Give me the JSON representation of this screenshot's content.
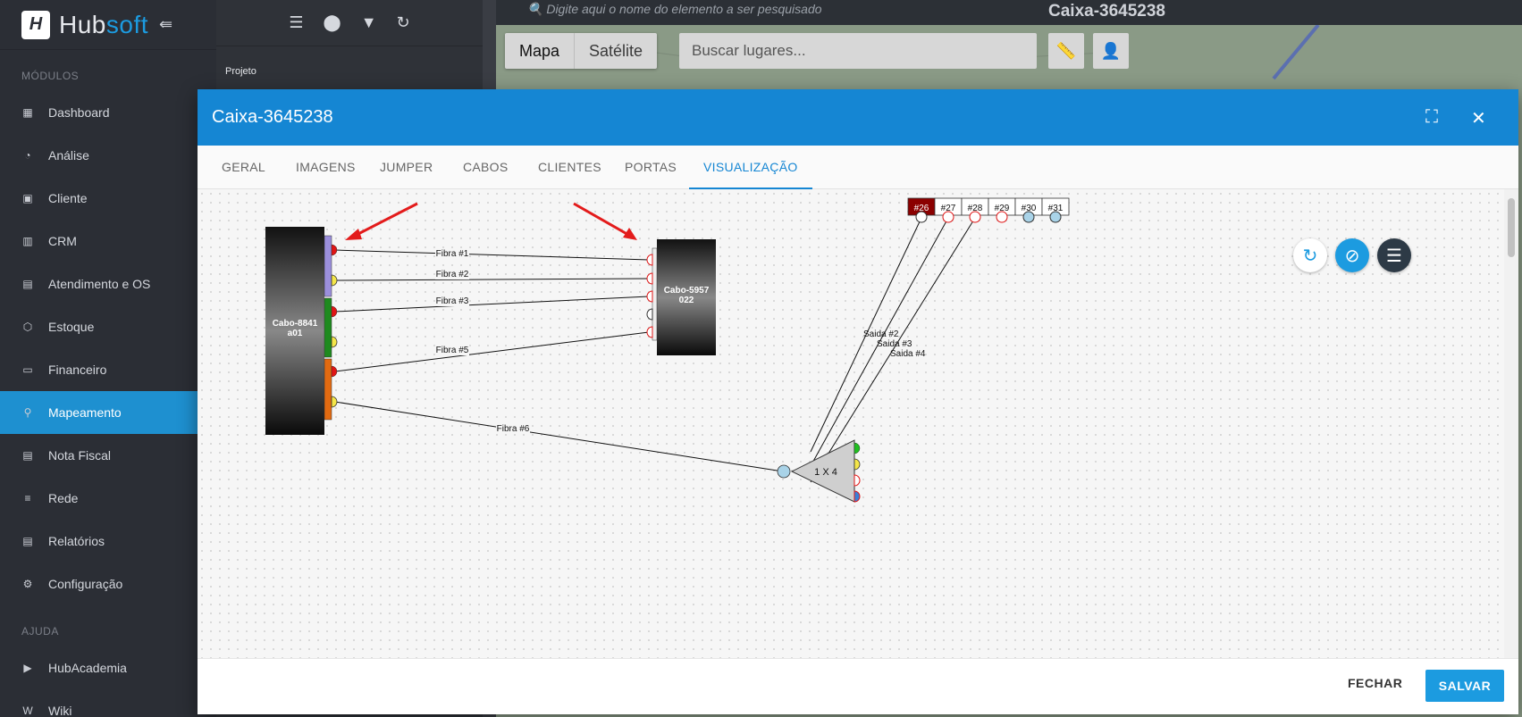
{
  "brand": {
    "hub": "Hub",
    "soft": "soft",
    "mark": "H",
    "collapse_icon": "collapse-menu-icon"
  },
  "sidebar": {
    "modules_label": "MÓDULOS",
    "items": [
      {
        "label": "Dashboard",
        "icon": "dashboard-icon"
      },
      {
        "label": "Análise",
        "icon": "pie-chart-icon"
      },
      {
        "label": "Cliente",
        "icon": "contact-card-icon",
        "chevron": true
      },
      {
        "label": "CRM",
        "icon": "trello-icon"
      },
      {
        "label": "Atendimento e OS",
        "icon": "calendar-clock-icon"
      },
      {
        "label": "Estoque",
        "icon": "box-icon"
      },
      {
        "label": "Financeiro",
        "icon": "money-icon"
      },
      {
        "label": "Mapeamento",
        "icon": "map-pin-icon",
        "active": true
      },
      {
        "label": "Nota Fiscal",
        "icon": "document-icon"
      },
      {
        "label": "Rede",
        "icon": "server-icon"
      },
      {
        "label": "Relatórios",
        "icon": "report-icon"
      },
      {
        "label": "Configuração",
        "icon": "gear-icon",
        "chevron": true
      }
    ],
    "help_label": "AJUDA",
    "help_items": [
      {
        "label": "HubAcademia",
        "icon": "youtube-icon"
      },
      {
        "label": "Wiki",
        "icon": "wikipedia-icon"
      }
    ]
  },
  "subpanel": {
    "project_label": "Projeto"
  },
  "map": {
    "search_placeholder": "Digite aqui o nome do elemento a ser pesquisado",
    "title": "Caixa-3645238",
    "type_map": "Mapa",
    "type_satellite": "Satélite",
    "places_placeholder": "Buscar lugares..."
  },
  "modal": {
    "title": "Caixa-3645238",
    "tabs": [
      "GERAL",
      "IMAGENS",
      "JUMPER",
      "CABOS",
      "CLIENTES",
      "PORTAS",
      "VISUALIZAÇÃO"
    ],
    "active_tab": "VISUALIZAÇÃO",
    "close_label": "FECHAR",
    "save_label": "SALVAR"
  },
  "diagram": {
    "cable_left": "Cabo-8841 a01",
    "cable_left_lines": [
      "Cabo-8841",
      "a01"
    ],
    "cable_right_lines": [
      "Cabo-5957",
      "022"
    ],
    "splitter_label": "1 X 4",
    "fibers": [
      "Fibra #1",
      "Fibra #2",
      "Fibra #3",
      "Fibra #5",
      "Fibra #6"
    ],
    "outputs": [
      "Saida #2",
      "Saida #3",
      "Saida #4"
    ],
    "ports": [
      "#26",
      "#27",
      "#28",
      "#29",
      "#30",
      "#31"
    ],
    "colors": {
      "port_active": "#8b0000",
      "segment_purple": "#9b8fdc",
      "segment_green": "#1e8a1e",
      "segment_orange": "#e26a10",
      "fiber_red": "#e01515",
      "fiber_yellow": "#f4e64a",
      "fiber_green": "#1fbf1f",
      "fiber_blue": "#3a7fd6",
      "port_lightblue": "#a9d3e8"
    }
  }
}
